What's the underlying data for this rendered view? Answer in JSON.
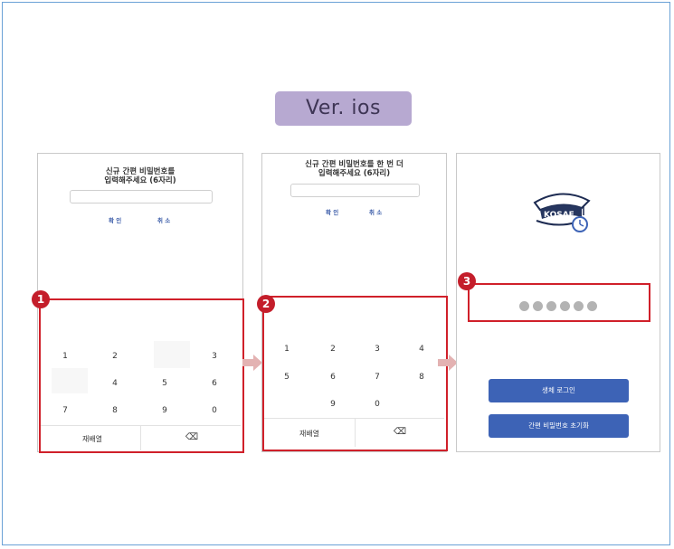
{
  "badge": {
    "label": "Ver. ios"
  },
  "screen1": {
    "step": "1",
    "title_line1": "신규 간편 비밀번호를",
    "title_line2": "입력해주세요 (6자리)",
    "confirm": "확 인",
    "cancel": "취 소",
    "keys": [
      "1",
      "2",
      "3",
      "4",
      "5",
      "6",
      "7",
      "8",
      "9",
      "0"
    ],
    "rearrange": "재배열",
    "backspace": "⌫"
  },
  "screen2": {
    "step": "2",
    "title_line1": "신규 간편 비밀번호를 한 번 더",
    "title_line2": "입력해주세요 (6자리)",
    "confirm": "확 인",
    "cancel": "취 소",
    "keys": [
      "1",
      "2",
      "3",
      "4",
      "5",
      "6",
      "7",
      "8",
      "9",
      "0"
    ],
    "rearrange": "재배열",
    "backspace": "⌫"
  },
  "screen3": {
    "step": "3",
    "logo_text": "KOSAF",
    "primary_button": "생체 로그인",
    "secondary_button": "간편 비밀번호 초기화"
  },
  "icons": {
    "arrow": "right-arrow-icon",
    "logo": "graduation-cap-clock-icon"
  },
  "colors": {
    "accent_red": "#d0202a",
    "badge_bg": "#b7a9d1",
    "button_blue": "#3d63b6",
    "frame_border": "#6aa1d6"
  }
}
